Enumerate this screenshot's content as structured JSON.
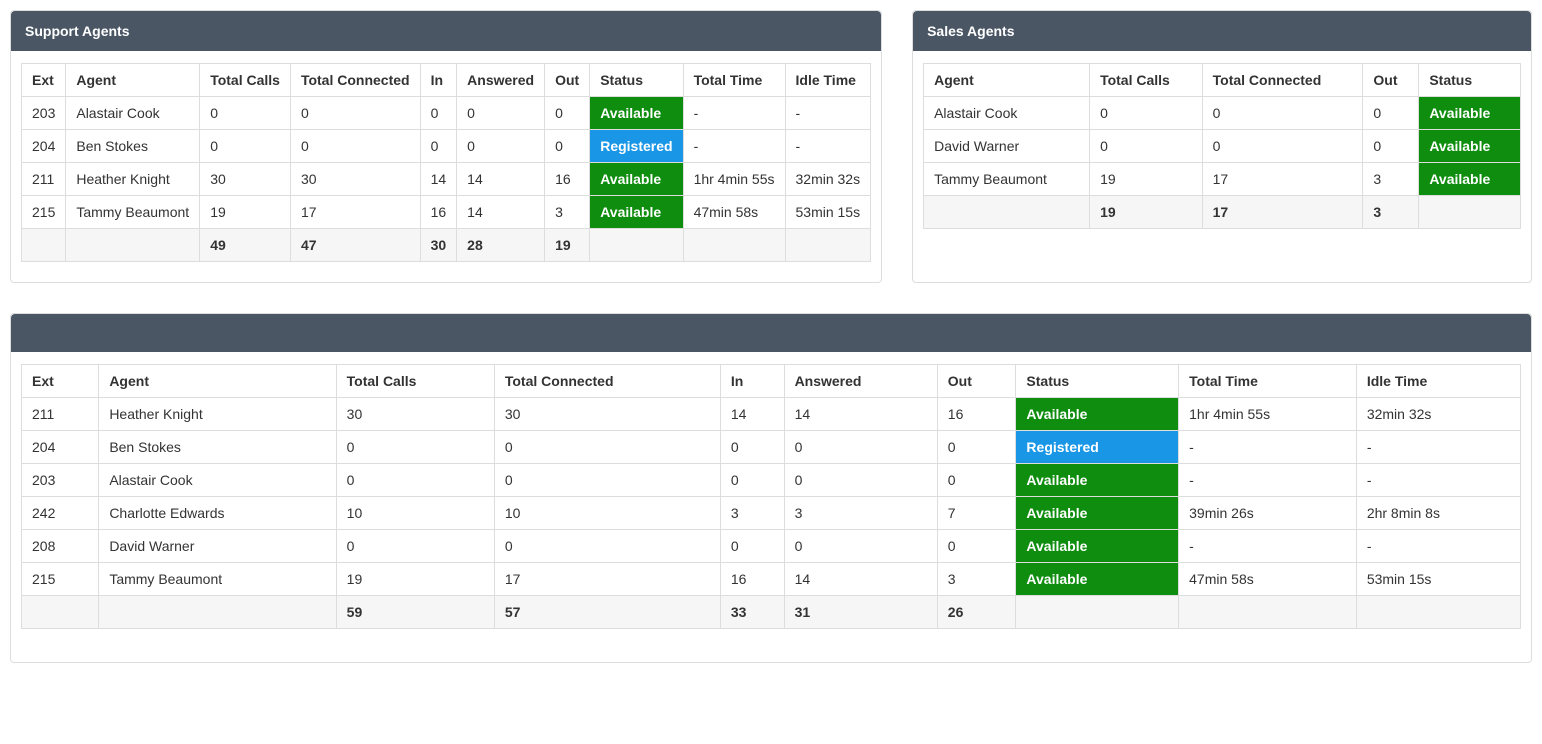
{
  "statuses": {
    "available": {
      "label": "Available",
      "class": "status-available"
    },
    "registered": {
      "label": "Registered",
      "class": "status-registered"
    }
  },
  "support": {
    "title": "Support Agents",
    "columns": [
      "Ext",
      "Agent",
      "Total Calls",
      "Total Connected",
      "In",
      "Answered",
      "Out",
      "Status",
      "Total Time",
      "Idle Time"
    ],
    "rows": [
      {
        "ext": "203",
        "agent": "Alastair Cook",
        "total_calls": "0",
        "total_connected": "0",
        "in": "0",
        "answered": "0",
        "out": "0",
        "status": "available",
        "total_time": "-",
        "idle_time": "-"
      },
      {
        "ext": "204",
        "agent": "Ben Stokes",
        "total_calls": "0",
        "total_connected": "0",
        "in": "0",
        "answered": "0",
        "out": "0",
        "status": "registered",
        "total_time": "-",
        "idle_time": "-"
      },
      {
        "ext": "211",
        "agent": "Heather Knight",
        "total_calls": "30",
        "total_connected": "30",
        "in": "14",
        "answered": "14",
        "out": "16",
        "status": "available",
        "total_time": "1hr 4min 55s",
        "idle_time": "32min 32s"
      },
      {
        "ext": "215",
        "agent": "Tammy Beaumont",
        "total_calls": "19",
        "total_connected": "17",
        "in": "16",
        "answered": "14",
        "out": "3",
        "status": "available",
        "total_time": "47min 58s",
        "idle_time": "53min 15s"
      }
    ],
    "totals": {
      "total_calls": "49",
      "total_connected": "47",
      "in": "30",
      "answered": "28",
      "out": "19"
    }
  },
  "sales": {
    "title": "Sales Agents",
    "columns": [
      "Agent",
      "Total Calls",
      "Total Connected",
      "Out",
      "Status"
    ],
    "rows": [
      {
        "agent": "Alastair Cook",
        "total_calls": "0",
        "total_connected": "0",
        "out": "0",
        "status": "available"
      },
      {
        "agent": "David Warner",
        "total_calls": "0",
        "total_connected": "0",
        "out": "0",
        "status": "available"
      },
      {
        "agent": "Tammy Beaumont",
        "total_calls": "19",
        "total_connected": "17",
        "out": "3",
        "status": "available"
      }
    ],
    "totals": {
      "total_calls": "19",
      "total_connected": "17",
      "out": "3"
    }
  },
  "all": {
    "columns": [
      "Ext",
      "Agent",
      "Total Calls",
      "Total Connected",
      "In",
      "Answered",
      "Out",
      "Status",
      "Total Time",
      "Idle Time"
    ],
    "rows": [
      {
        "ext": "211",
        "agent": "Heather Knight",
        "total_calls": "30",
        "total_connected": "30",
        "in": "14",
        "answered": "14",
        "out": "16",
        "status": "available",
        "total_time": "1hr 4min 55s",
        "idle_time": "32min 32s"
      },
      {
        "ext": "204",
        "agent": "Ben Stokes",
        "total_calls": "0",
        "total_connected": "0",
        "in": "0",
        "answered": "0",
        "out": "0",
        "status": "registered",
        "total_time": "-",
        "idle_time": "-"
      },
      {
        "ext": "203",
        "agent": "Alastair Cook",
        "total_calls": "0",
        "total_connected": "0",
        "in": "0",
        "answered": "0",
        "out": "0",
        "status": "available",
        "total_time": "-",
        "idle_time": "-"
      },
      {
        "ext": "242",
        "agent": "Charlotte Edwards",
        "total_calls": "10",
        "total_connected": "10",
        "in": "3",
        "answered": "3",
        "out": "7",
        "status": "available",
        "total_time": "39min 26s",
        "idle_time": "2hr 8min 8s"
      },
      {
        "ext": "208",
        "agent": "David Warner",
        "total_calls": "0",
        "total_connected": "0",
        "in": "0",
        "answered": "0",
        "out": "0",
        "status": "available",
        "total_time": "-",
        "idle_time": "-"
      },
      {
        "ext": "215",
        "agent": "Tammy Beaumont",
        "total_calls": "19",
        "total_connected": "17",
        "in": "16",
        "answered": "14",
        "out": "3",
        "status": "available",
        "total_time": "47min 58s",
        "idle_time": "53min 15s"
      }
    ],
    "totals": {
      "total_calls": "59",
      "total_connected": "57",
      "in": "33",
      "answered": "31",
      "out": "26"
    }
  }
}
